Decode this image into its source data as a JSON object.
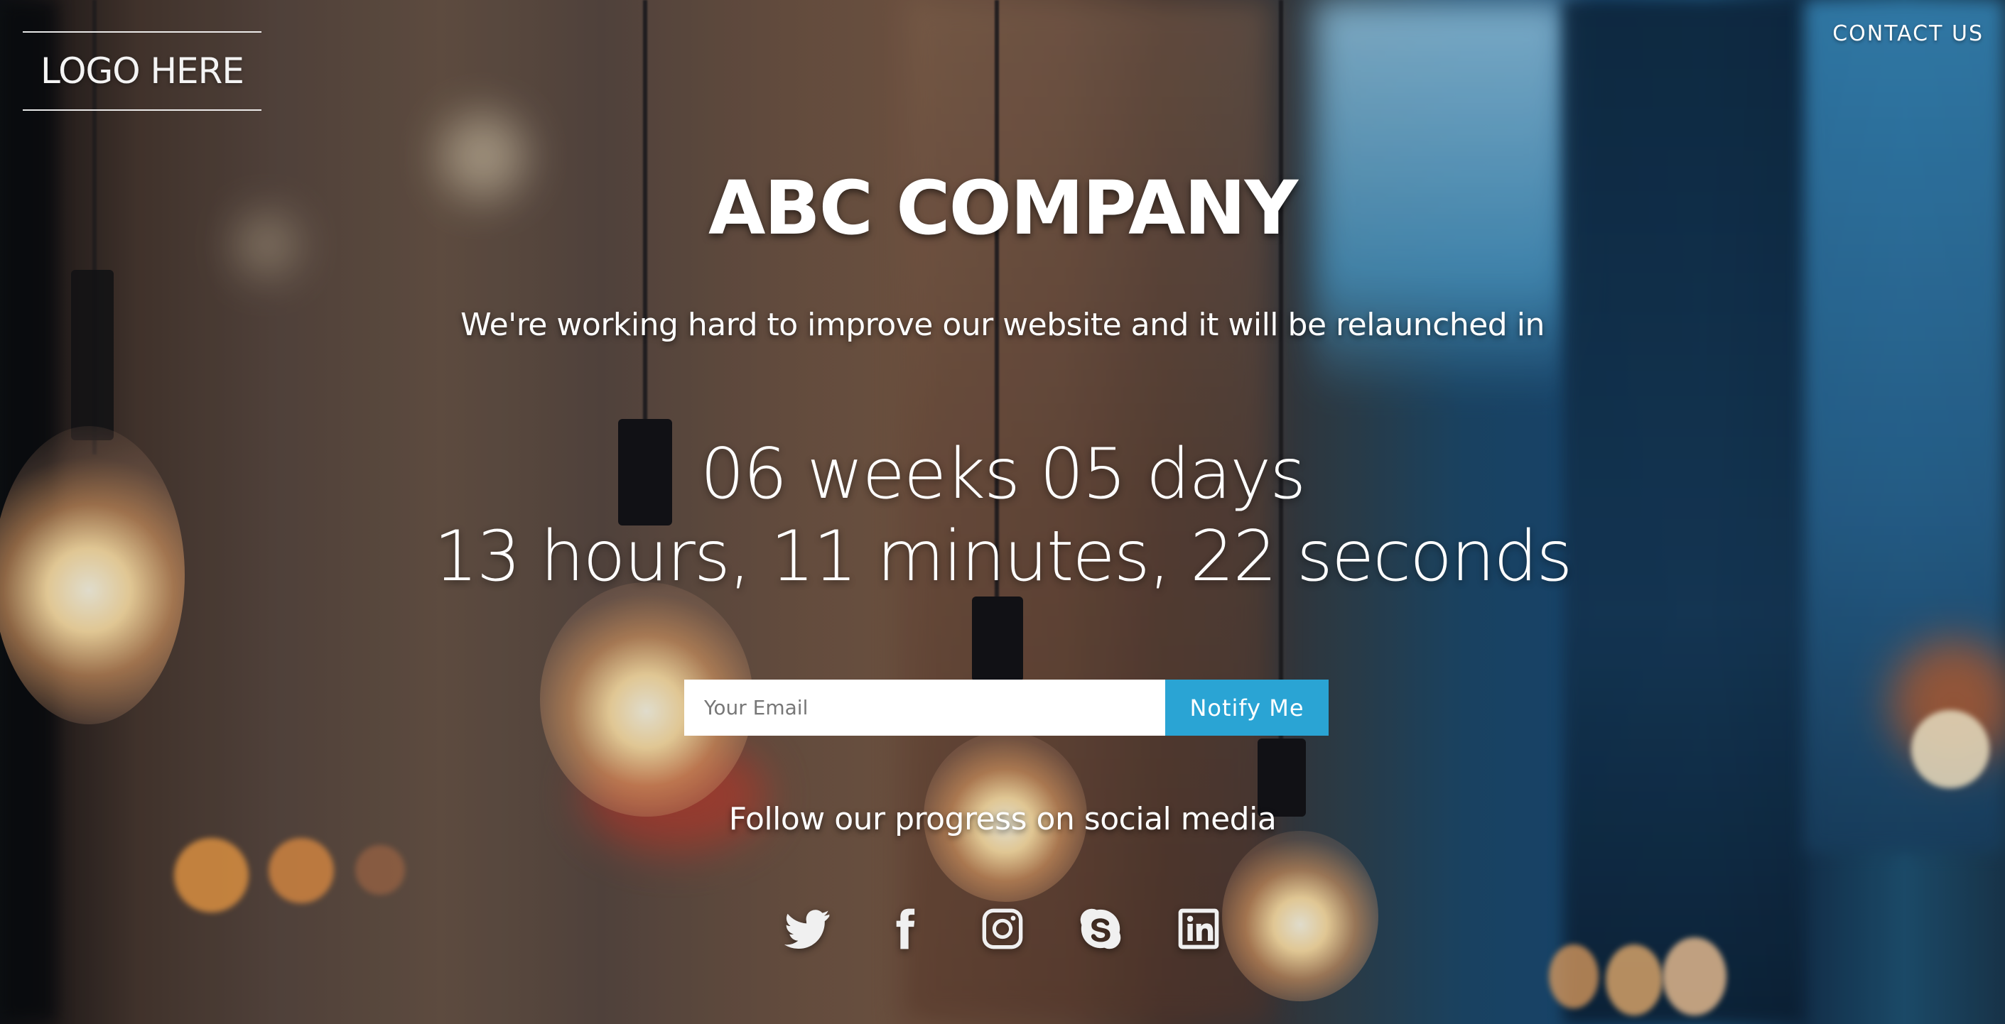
{
  "header": {
    "logo_text": "LOGO HERE",
    "contact_label": "CONTACT US"
  },
  "hero": {
    "company_name": "ABC COMPANY",
    "tagline": "We're working hard to improve our website and it will be relaunched in",
    "countdown_line1": "06 weeks 05 days",
    "countdown_line2": "13 hours, 11 minutes, 22 seconds"
  },
  "signup": {
    "email_placeholder": "Your Email",
    "email_value": "",
    "button_label": "Notify Me",
    "button_color": "#2aa4d4"
  },
  "social": {
    "heading": "Follow our progress on social media",
    "icons": [
      "twitter-icon",
      "facebook-icon",
      "instagram-icon",
      "skype-icon",
      "linkedin-icon"
    ]
  }
}
